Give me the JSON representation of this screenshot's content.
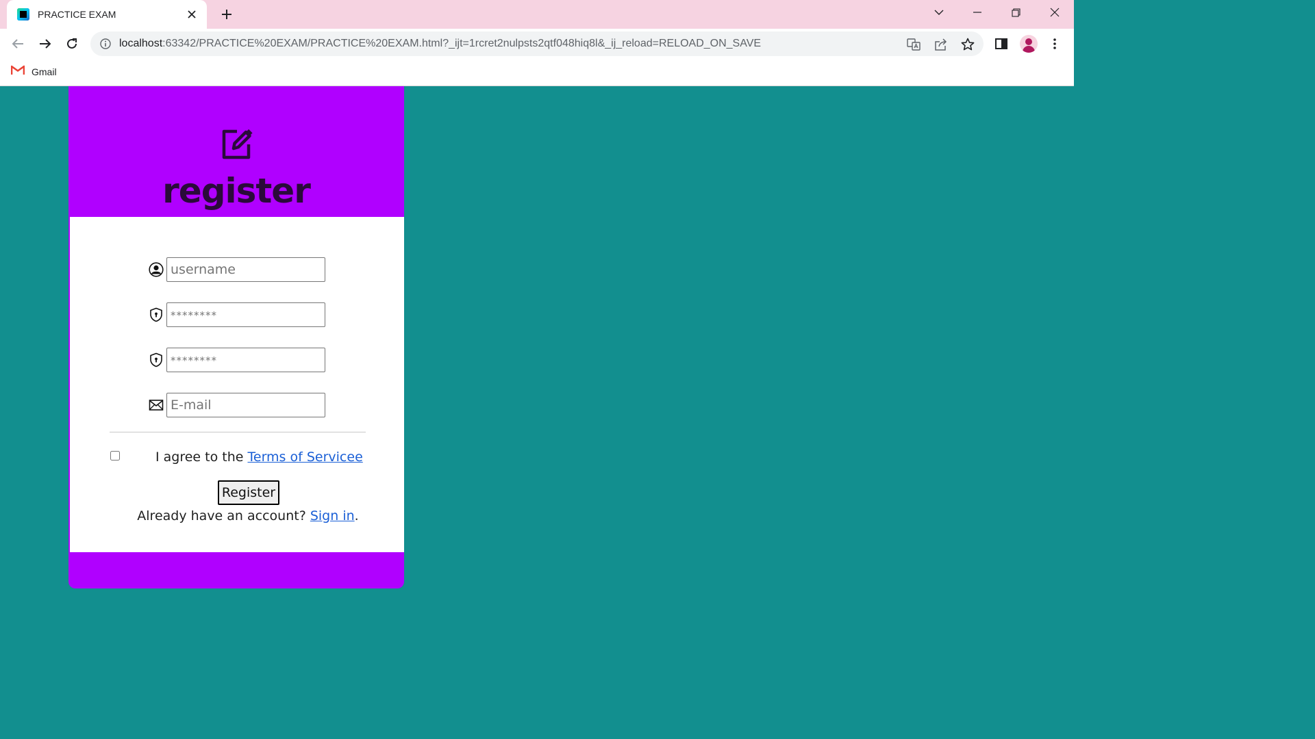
{
  "browser": {
    "tab_title": "PRACTICE EXAM",
    "url_host": "localhost",
    "url_rest": ":63342/PRACTICE%20EXAM/PRACTICE%20EXAM.html?_ijt=1rcret2nulpsts2qtf048hiq8l&_ij_reload=RELOAD_ON_SAVE",
    "bookmark_gmail": "Gmail"
  },
  "form": {
    "title": "register",
    "username_placeholder": "username",
    "password_placeholder": "********",
    "confirm_placeholder": "********",
    "email_placeholder": "E-mail",
    "agree_prefix": "I agree to the ",
    "terms_link": "Terms of Servicee",
    "register_button": "Register",
    "already_text": "Already have an account? ",
    "signin_link": "Sign in",
    "already_suffix": "."
  },
  "colors": {
    "page_background": "#128f8f",
    "card_accent": "#b000ff",
    "tab_strip": "#f6d3e1",
    "link": "#1a5fd6"
  },
  "icons": {
    "header": "edit-icon",
    "username": "user-circle-icon",
    "password": "shield-lock-icon",
    "confirm": "shield-lock-icon",
    "email": "envelope-icon"
  }
}
